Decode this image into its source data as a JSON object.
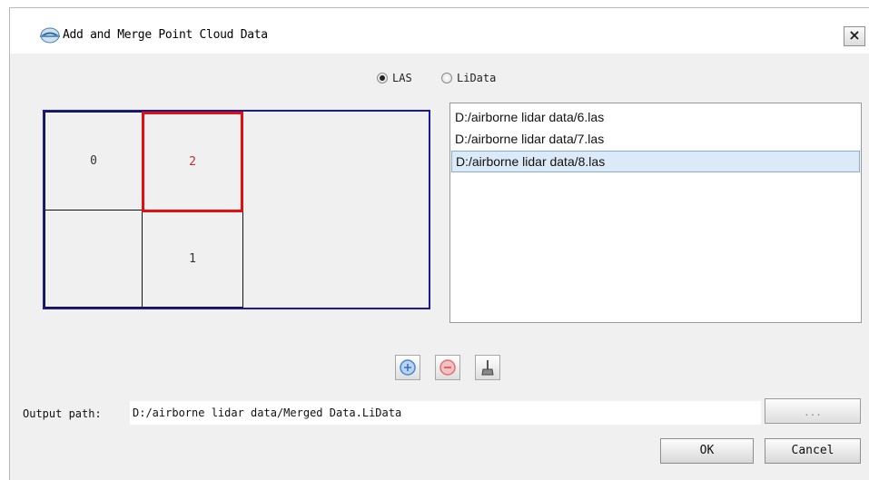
{
  "window": {
    "title": "Add and Merge Point Cloud Data",
    "close_glyph": "×"
  },
  "format": {
    "options": [
      {
        "label": "LAS",
        "selected": true
      },
      {
        "label": "LiData",
        "selected": false
      }
    ]
  },
  "tiles": {
    "labels": [
      "0",
      "2",
      "1"
    ],
    "selected": "2",
    "selected_color": "#e01010"
  },
  "files": {
    "items": [
      "D:/airborne lidar data/6.las",
      "D:/airborne lidar data/7.las",
      "D:/airborne lidar data/8.las"
    ],
    "selected_index": 2
  },
  "toolbar": {
    "icons": [
      "add-icon",
      "remove-icon",
      "clear-icon"
    ]
  },
  "output": {
    "label": "Output path:",
    "value": "D:/airborne lidar data/Merged Data.LiData",
    "browse_label": "..."
  },
  "actions": {
    "ok": "OK",
    "cancel": "Cancel"
  }
}
